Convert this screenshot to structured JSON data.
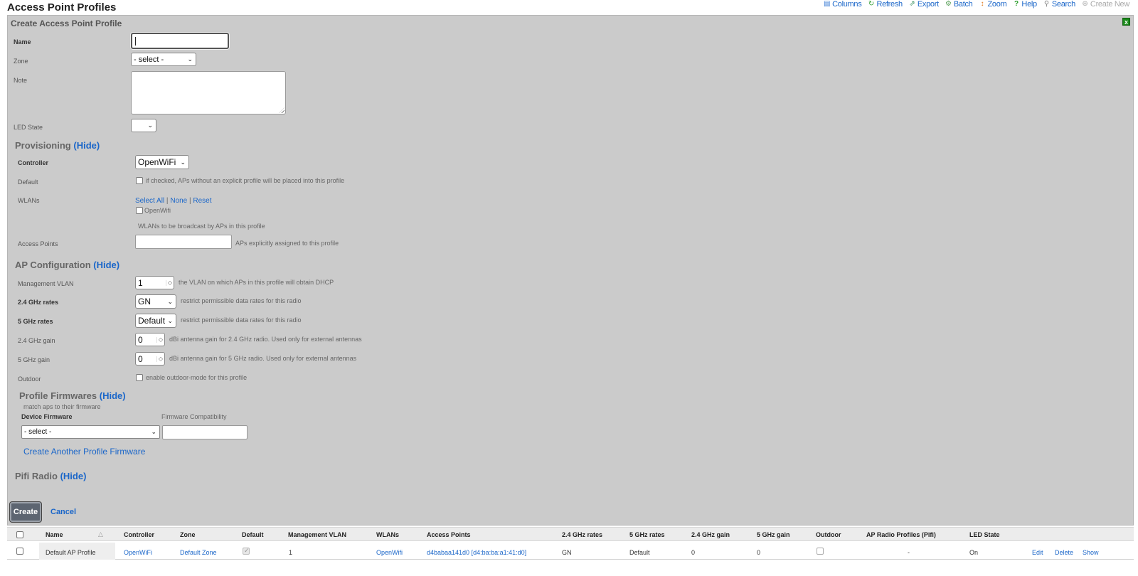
{
  "page": {
    "title": "Access Point Profiles"
  },
  "toolbar": {
    "items": [
      {
        "label": "Columns",
        "icon": "columns-icon"
      },
      {
        "label": "Refresh",
        "icon": "refresh-icon"
      },
      {
        "label": "Export",
        "icon": "export-icon"
      },
      {
        "label": "Batch",
        "icon": "batch-icon"
      },
      {
        "label": "Zoom",
        "icon": "zoom-icon"
      },
      {
        "label": "Help",
        "icon": "help-icon"
      },
      {
        "label": "Search",
        "icon": "search-icon"
      },
      {
        "label": "Create New",
        "icon": "create-new-icon",
        "disabled": true
      }
    ]
  },
  "form": {
    "title": "Create Access Point Profile",
    "name_label": "Name",
    "name_value": "",
    "zone_label": "Zone",
    "zone_value": "- select -",
    "note_label": "Note",
    "led_label": "LED State",
    "led_value": "",
    "provisioning": {
      "title": "Provisioning",
      "hide": "(Hide)",
      "controller_label": "Controller",
      "controller_value": "OpenWiFi",
      "default_label": "Default",
      "default_hint": "if checked, APs without an explicit profile will be placed into this profile",
      "wlans_label": "WLANs",
      "select_all": "Select All",
      "sep": "|",
      "none": "None",
      "reset": "Reset",
      "wlan_option": "OpenWifi",
      "wlans_hint": "WLANs to be broadcast by APs in this profile",
      "aps_label": "Access Points",
      "aps_hint": "APs explicitly assigned to this profile"
    },
    "ap_config": {
      "title": "AP Configuration",
      "hide": "(Hide)",
      "vlan_label": "Management VLAN",
      "vlan_value": "1",
      "vlan_hint": "the VLAN on which APs in this profile will obtain DHCP",
      "r24_label": "2.4 GHz rates",
      "r24_value": "GN",
      "r24_hint": "restrict permissible data rates for this radio",
      "r5_label": "5 GHz rates",
      "r5_value": "Default",
      "r5_hint": "restrict permissible data rates for this radio",
      "g24_label": "2.4 GHz gain",
      "g24_value": "0",
      "g24_hint": "dBi antenna gain for 2.4 GHz radio. Used only for external antennas",
      "g5_label": "5 GHz gain",
      "g5_value": "0",
      "g5_hint": "dBi antenna gain for 5 GHz radio. Used only for external antennas",
      "outdoor_label": "Outdoor",
      "outdoor_hint": "enable outdoor-mode for this profile"
    },
    "firmware": {
      "title": "Profile Firmwares",
      "hide": "(Hide)",
      "subtitle": "match aps to their firmware",
      "col_device": "Device Firmware",
      "col_compat": "Firmware Compatibility",
      "device_value": "- select -",
      "create_another": "Create Another Profile Firmware"
    },
    "pifi": {
      "title": "Pifi Radio",
      "hide": "(Hide)"
    },
    "create": "Create",
    "cancel": "Cancel"
  },
  "table": {
    "columns": [
      "Name",
      "Controller",
      "Zone",
      "Default",
      "Management VLAN",
      "WLANs",
      "Access Points",
      "2.4 GHz rates",
      "5 GHz rates",
      "2.4 GHz gain",
      "5 GHz gain",
      "Outdoor",
      "AP Radio Profiles (Pifi)",
      "LED State"
    ],
    "rows": [
      {
        "name": "Default AP Profile",
        "controller": "OpenWiFi",
        "zone": "Default Zone",
        "default": true,
        "vlan": "1",
        "wlans": "OpenWifi",
        "aps": "d4babaa141d0 [d4:ba:ba:a1:41:d0]",
        "r24": "GN",
        "r5": "Default",
        "g24": "0",
        "g5": "0",
        "outdoor": false,
        "pifi": "-",
        "led": "On",
        "actions": [
          "Edit",
          "Delete",
          "Show"
        ]
      }
    ]
  }
}
